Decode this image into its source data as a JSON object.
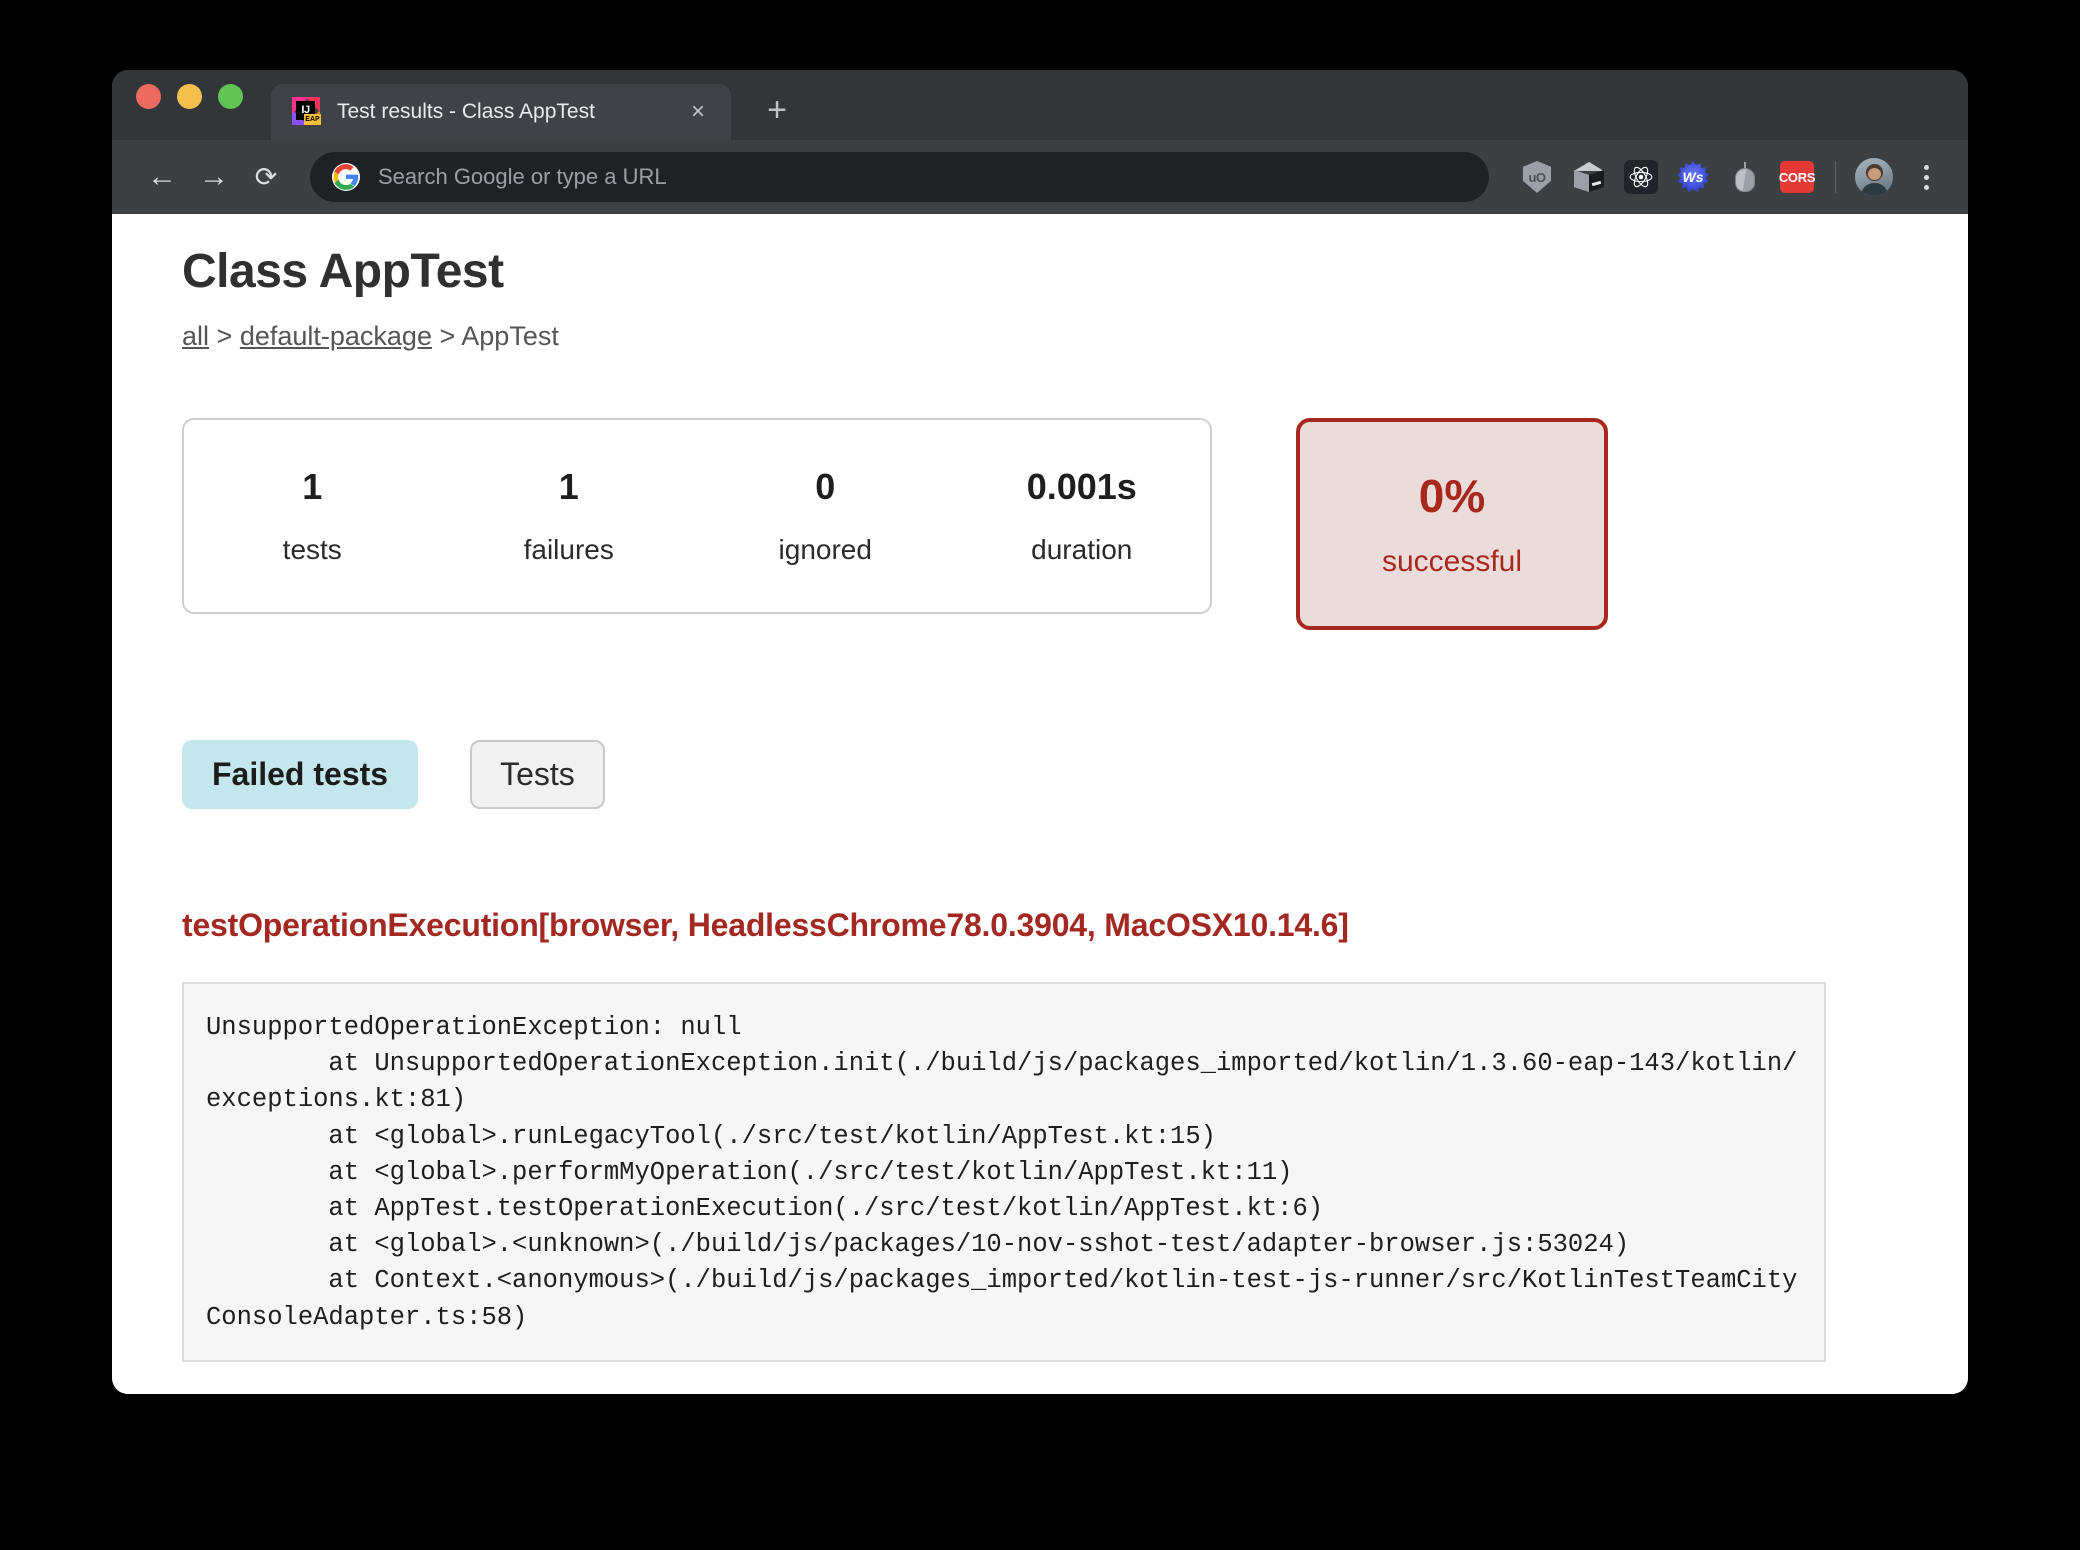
{
  "browser": {
    "tab": {
      "title": "Test results - Class AppTest",
      "favicon_name": "intellij-idea-eap-icon",
      "favicon_letters": "IJ",
      "favicon_badge": "EAP",
      "close_label": "×"
    },
    "new_tab_label": "+",
    "nav": {
      "back_label": "←",
      "forward_label": "→",
      "reload_label": "⟳"
    },
    "omnibox": {
      "placeholder": "Search Google or type a URL",
      "value": "",
      "icon_name": "google-g-icon"
    },
    "extensions": [
      {
        "name": "ublock-origin-icon",
        "label": "uO"
      },
      {
        "name": "cube-extension-icon",
        "label": ""
      },
      {
        "name": "react-devtools-icon",
        "label": ""
      },
      {
        "name": "ws-extension-icon",
        "label": "Ws"
      },
      {
        "name": "mouse-extension-icon",
        "label": ""
      },
      {
        "name": "cors-extension-icon",
        "label": "CORS"
      }
    ],
    "profile_name": "profile-avatar",
    "menu_name": "chrome-menu-icon"
  },
  "page": {
    "title": "Class AppTest",
    "breadcrumb": {
      "items": [
        {
          "label": "all",
          "link": true
        },
        {
          "label": "default-package",
          "link": true
        },
        {
          "label": "AppTest",
          "link": false
        }
      ],
      "separator": ">"
    },
    "stats": [
      {
        "value": "1",
        "label": "tests"
      },
      {
        "value": "1",
        "label": "failures"
      },
      {
        "value": "0",
        "label": "ignored"
      },
      {
        "value": "0.001s",
        "label": "duration"
      }
    ],
    "success": {
      "percent": "0%",
      "label": "successful",
      "border_color": "#A9281D",
      "background_color": "#EBDCDB",
      "text_color": "#A9281D"
    },
    "tabs": [
      {
        "label": "Failed tests",
        "active": true
      },
      {
        "label": "Tests",
        "active": false
      }
    ],
    "failed_test": {
      "name": "testOperationExecution[browser, HeadlessChrome78.0.3904, MacOSX10.14.6]",
      "color": "#A32821",
      "stacktrace": "UnsupportedOperationException: null\n        at UnsupportedOperationException.init(./build/js/packages_imported/kotlin/1.3.60-eap-143/kotlin/exceptions.kt:81)\n        at <global>.runLegacyTool(./src/test/kotlin/AppTest.kt:15)\n        at <global>.performMyOperation(./src/test/kotlin/AppTest.kt:11)\n        at AppTest.testOperationExecution(./src/test/kotlin/AppTest.kt:6)\n        at <global>.<unknown>(./build/js/packages/10-nov-sshot-test/adapter-browser.js:53024)\n        at Context.<anonymous>(./build/js/packages_imported/kotlin-test-js-runner/src/KotlinTestTeamCityConsoleAdapter.ts:58)"
    }
  }
}
